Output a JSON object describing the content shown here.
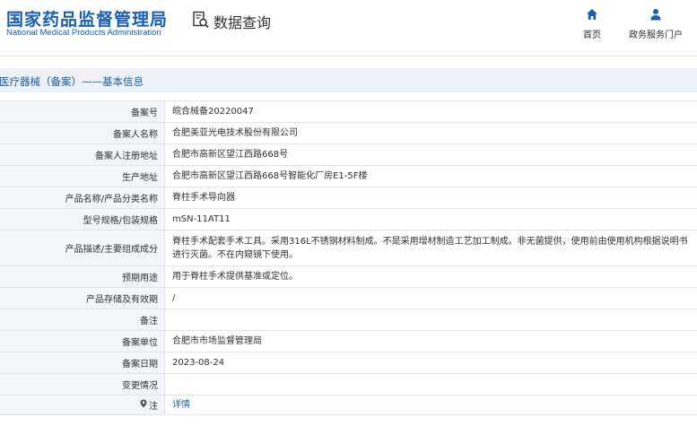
{
  "header": {
    "logo_cn": "国家药品监督管理局",
    "logo_en": "National Medical Products Administration",
    "query_icon": "search-document-icon",
    "query_label": "数据查询",
    "nav": [
      {
        "icon": "home-icon",
        "label": "首页"
      },
      {
        "icon": "user-icon",
        "label": "政务服务门户"
      }
    ]
  },
  "page_title": "医疗器械（备案）——基本信息",
  "rows": [
    {
      "label": "备案号",
      "value": "皖合械备20220047"
    },
    {
      "label": "备案人名称",
      "value": "合肥美亚光电技术股份有限公司"
    },
    {
      "label": "备案人注册地址",
      "value": "合肥市高新区望江西路668号"
    },
    {
      "label": "生产地址",
      "value": "合肥市高新区望江西路668号智能化厂房E1-5F楼"
    },
    {
      "label": "产品名称/产品分类名称",
      "value": "脊柱手术导向器"
    },
    {
      "label": "型号规格/包装规格",
      "value": "mSN-11AT11"
    },
    {
      "label": "产品描述/主要组成成分",
      "value": "脊柱手术配套手术工具。采用316L不锈钢材料制成。不是采用增材制造工艺加工制成。非无菌提供，使用前由使用机构根据说明书进行灭菌。不在内窥镜下使用。"
    },
    {
      "label": "预期用途",
      "value": "用于脊柱手术提供基准或定位。"
    },
    {
      "label": "产品存储及有效期",
      "value": "/"
    },
    {
      "label": "备注",
      "value": ""
    },
    {
      "label": "备案单位",
      "value": "合肥市市场监督管理局"
    },
    {
      "label": "备案日期",
      "value": "2023-08-24"
    },
    {
      "label": "变更情况",
      "value": ""
    },
    {
      "label": "注",
      "value": "详情"
    }
  ],
  "colors": {
    "brand": "#1a5fb4",
    "label_bg": "#f3f5f8",
    "title_bg": "#eef2f6"
  }
}
